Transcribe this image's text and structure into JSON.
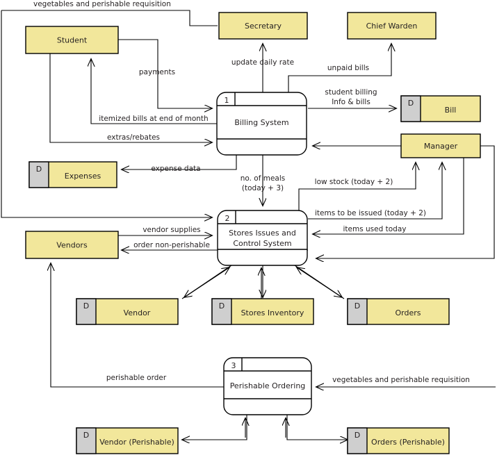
{
  "diagram": {
    "title": "Hostel Management Data Flow Diagram",
    "colors": {
      "entity_fill": "#f2e79b",
      "store_fill": "#f2e79b",
      "store_tag_fill": "#cfcfcf",
      "process_band": "#f2e79b",
      "process_body": "#ffffff",
      "stroke": "#000000",
      "text": "#231f20"
    },
    "external_entities": [
      {
        "id": "student",
        "label": "Student"
      },
      {
        "id": "secretary",
        "label": "Secretary"
      },
      {
        "id": "chief_warden",
        "label": "Chief Warden"
      },
      {
        "id": "manager",
        "label": "Manager"
      },
      {
        "id": "vendors",
        "label": "Vendors"
      }
    ],
    "processes": [
      {
        "id": "p1",
        "number": "1",
        "label": "Billing System"
      },
      {
        "id": "p2",
        "number": "2",
        "label_line1": "Stores Issues and",
        "label_line2": "Control System"
      },
      {
        "id": "p3",
        "number": "3",
        "label": "Perishable Ordering"
      }
    ],
    "data_stores": [
      {
        "id": "bill",
        "tag": "D",
        "label": "Bill"
      },
      {
        "id": "expenses",
        "tag": "D",
        "label": "Expenses"
      },
      {
        "id": "vendor",
        "tag": "D",
        "label": "Vendor"
      },
      {
        "id": "inventory",
        "tag": "D",
        "label": "Stores Inventory"
      },
      {
        "id": "orders",
        "tag": "D",
        "label": "Orders"
      },
      {
        "id": "vendor_per",
        "tag": "D",
        "label": "Vendor (Perishable)"
      },
      {
        "id": "orders_per",
        "tag": "D",
        "label": "Orders (Perishable)"
      }
    ],
    "flow_labels": {
      "veg_req_top": "vegetables and perishable requisition",
      "payments": "payments",
      "update_daily_rate": "update daily rate",
      "unpaid_bills": "unpaid bills",
      "student_billing_l1": "student billing",
      "student_billing_l2": "Info & bills",
      "itemized_bills": "itemized bills at end of month",
      "extras_rebates": "extras/rebates",
      "expense_data": "expense data",
      "no_of_meals_l1": "no. of meals",
      "no_of_meals_l2": "(today + 3)",
      "low_stock": "low stock (today + 2)",
      "items_to_be_issued": "items to be issued (today + 2)",
      "items_used_today": "items used today",
      "vendor_supplies": "vendor supplies",
      "order_non_perishable": "order non-perishable",
      "perishable_order": "perishable order",
      "veg_req_right": "vegetables and perishable requisition"
    }
  }
}
